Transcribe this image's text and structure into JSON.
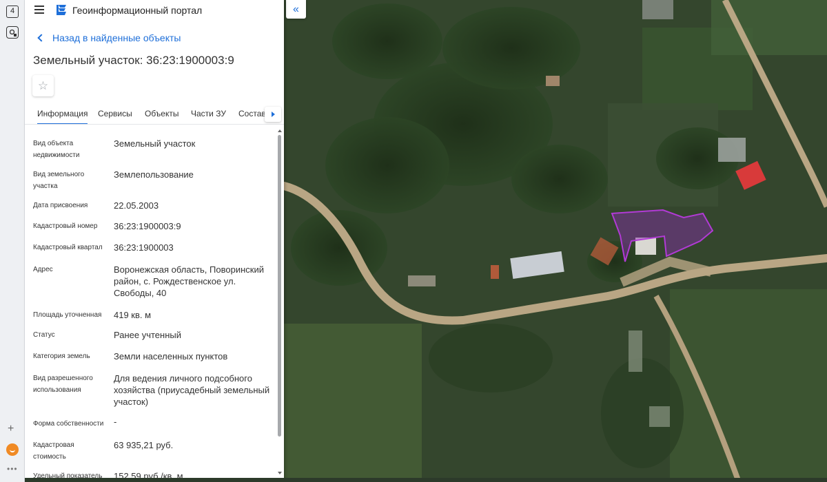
{
  "os_strip": {
    "badge_number": "4",
    "bottom_dots": "•••",
    "icons": [
      "tab-counter-icon",
      "screenshot-icon",
      "plus-icon",
      "odnoklassniki-icon",
      "more-dots-icon"
    ]
  },
  "header": {
    "app_title": "Геоинформационный портал",
    "icons": [
      "hamburger-menu-icon",
      "portal-logo-icon"
    ]
  },
  "navigation": {
    "back_label": "Назад в найденные объекты"
  },
  "object": {
    "title": "Земельный участок: 36:23:1900003:9",
    "favorite_icon": "☆"
  },
  "tabs": [
    {
      "label": "Информация",
      "active": true
    },
    {
      "label": "Сервисы",
      "active": false
    },
    {
      "label": "Объекты",
      "active": false
    },
    {
      "label": "Части ЗУ",
      "active": false
    },
    {
      "label": "Состав",
      "active": false
    }
  ],
  "properties": [
    {
      "label": "Вид объекта недвижимости",
      "value": "Земельный участок"
    },
    {
      "label": "Вид земельного участка",
      "value": "Землепользование"
    },
    {
      "label": "Дата присвоения",
      "value": "22.05.2003"
    },
    {
      "label": "Кадастровый номер",
      "value": "36:23:1900003:9"
    },
    {
      "label": "Кадастровый квартал",
      "value": "36:23:1900003"
    },
    {
      "label": "Адрес",
      "value": "Воронежская область, Поворинский район, с. Рождественское ул. Свободы, 40"
    },
    {
      "label": "Площадь уточненная",
      "value": "419 кв. м"
    },
    {
      "label": "Статус",
      "value": "Ранее учтенный"
    },
    {
      "label": "Категория земель",
      "value": "Земли населенных пунктов"
    },
    {
      "label": "Вид разрешенного использования",
      "value": "Для ведения личного подсобного хозяйства (приусадебный земельный участок)"
    },
    {
      "label": "Форма собственности",
      "value": "-"
    },
    {
      "label": "Кадастровая стоимость",
      "value": "63 935,21 руб."
    },
    {
      "label": "Удельный показатель",
      "value": "152,59 руб./кв. м"
    }
  ],
  "map": {
    "collapse_label": "«",
    "parcel_outline_color": "#b23ad6",
    "parcel_fill_color": "#8a2db0"
  }
}
